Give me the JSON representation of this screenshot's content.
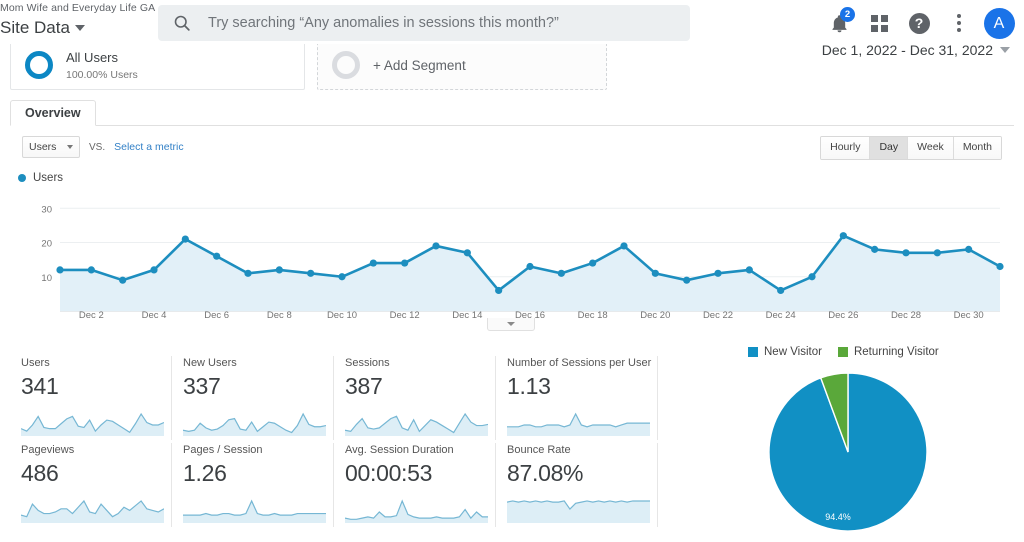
{
  "header": {
    "property_name": "Mom Wife and Everyday Life GA",
    "view_name": "Site Data",
    "search_placeholder": "Try searching “Any anomalies in sessions this month?”",
    "search_value": "",
    "search_icon": "search-icon",
    "notifications_icon": "bell-icon",
    "notifications_badge": "2",
    "apps_icon": "apps-grid-icon",
    "help_icon": "help-icon",
    "help_glyph": "?",
    "more_icon": "kebab-menu-icon",
    "avatar_initial": "A",
    "date_range": "Dec 1, 2022 - Dec 31, 2022"
  },
  "segments": {
    "all_users": {
      "title": "All Users",
      "subtitle": "100.00% Users"
    },
    "add_segment_label": "+ Add Segment"
  },
  "tabs": [
    {
      "label": "Overview",
      "active": true
    }
  ],
  "controls": {
    "metric_selected": "Users",
    "vs_label": "VS.",
    "select_metric_link": "Select a metric",
    "granularity": [
      {
        "label": "Hourly",
        "active": false
      },
      {
        "label": "Day",
        "active": true
      },
      {
        "label": "Week",
        "active": false
      },
      {
        "label": "Month",
        "active": false
      }
    ]
  },
  "colors": {
    "line": "#1d8ebf",
    "area": "#e2f0f8",
    "sparkline": "#76b7d4",
    "spark_area": "#ddeef6",
    "pie_new": "#1190c4",
    "pie_returning": "#5aa83a",
    "accent_link": "#3381c7"
  },
  "chart_data": [
    {
      "type": "line",
      "title": "Users",
      "legend": [
        "Users"
      ],
      "legend_position": "top-left",
      "xlabel": "",
      "ylabel": "",
      "ylim": [
        0,
        33
      ],
      "yticks": [
        10,
        20,
        30
      ],
      "grid": true,
      "x": [
        "Dec 1",
        "Dec 2",
        "Dec 3",
        "Dec 4",
        "Dec 5",
        "Dec 6",
        "Dec 7",
        "Dec 8",
        "Dec 9",
        "Dec 10",
        "Dec 11",
        "Dec 12",
        "Dec 13",
        "Dec 14",
        "Dec 15",
        "Dec 16",
        "Dec 17",
        "Dec 18",
        "Dec 19",
        "Dec 20",
        "Dec 21",
        "Dec 22",
        "Dec 23",
        "Dec 24",
        "Dec 25",
        "Dec 26",
        "Dec 27",
        "Dec 28",
        "Dec 29",
        "Dec 30",
        "Dec 31"
      ],
      "xtick_labels": [
        "Dec 2",
        "Dec 4",
        "Dec 6",
        "Dec 8",
        "Dec 10",
        "Dec 12",
        "Dec 14",
        "Dec 16",
        "Dec 18",
        "Dec 20",
        "Dec 22",
        "Dec 24",
        "Dec 26",
        "Dec 28",
        "Dec 30"
      ],
      "values": [
        12,
        12,
        9,
        12,
        21,
        16,
        11,
        12,
        11,
        10,
        14,
        14,
        19,
        17,
        6,
        13,
        11,
        14,
        19,
        11,
        9,
        11,
        12,
        6,
        10,
        22,
        18,
        17,
        17,
        18,
        13
      ]
    },
    {
      "type": "pie",
      "title": "",
      "legend_position": "top",
      "labels": [
        "New Visitor",
        "Returning Visitor"
      ],
      "values": [
        94.4,
        5.6
      ],
      "data_labels": [
        "94.4%",
        ""
      ],
      "colors": [
        "#1190c4",
        "#5aa83a"
      ]
    }
  ],
  "metric_cards": [
    {
      "label": "Users",
      "value": "341",
      "spark": [
        6,
        4,
        9,
        16,
        7,
        6,
        6,
        10,
        14,
        16,
        8,
        7,
        13,
        4,
        9,
        13,
        12,
        9,
        6,
        3,
        10,
        18,
        11,
        9,
        9,
        11
      ]
    },
    {
      "label": "New Users",
      "value": "337",
      "spark": [
        5,
        4,
        5,
        11,
        7,
        5,
        6,
        9,
        14,
        15,
        6,
        5,
        12,
        4,
        8,
        12,
        11,
        8,
        5,
        3,
        9,
        19,
        10,
        8,
        8,
        9
      ]
    },
    {
      "label": "Sessions",
      "value": "387",
      "spark": [
        5,
        4,
        10,
        15,
        7,
        6,
        7,
        11,
        15,
        17,
        7,
        5,
        14,
        4,
        9,
        14,
        12,
        9,
        6,
        3,
        11,
        19,
        12,
        9,
        9,
        10
      ]
    },
    {
      "label": "Number of Sessions per User",
      "value": "1.13",
      "spark": [
        5,
        5,
        5,
        6,
        6,
        5,
        5,
        6,
        6,
        6,
        5,
        6,
        12,
        6,
        5,
        6,
        6,
        6,
        6,
        5,
        6,
        7,
        7,
        7,
        7,
        7
      ]
    },
    {
      "label": "Pageviews",
      "value": "486",
      "spark": [
        5,
        4,
        12,
        8,
        6,
        6,
        7,
        9,
        9,
        6,
        10,
        14,
        7,
        6,
        12,
        8,
        4,
        6,
        10,
        8,
        11,
        14,
        9,
        8,
        7,
        9
      ]
    },
    {
      "label": "Pages / Session",
      "value": "1.26",
      "spark": [
        5,
        5,
        5,
        5,
        6,
        5,
        5,
        6,
        6,
        5,
        5,
        6,
        14,
        6,
        5,
        5,
        6,
        5,
        5,
        5,
        6,
        6,
        6,
        6,
        6,
        6
      ]
    },
    {
      "label": "Avg. Session Duration",
      "value": "00:00:53",
      "spark": [
        4,
        3,
        3,
        4,
        5,
        4,
        9,
        5,
        5,
        6,
        18,
        7,
        5,
        4,
        4,
        4,
        5,
        4,
        4,
        4,
        5,
        11,
        4,
        9,
        5,
        5
      ]
    },
    {
      "label": "Bounce Rate",
      "value": "87.08%",
      "spark": [
        18,
        19,
        18,
        19,
        18,
        19,
        18,
        19,
        18,
        18,
        19,
        12,
        17,
        18,
        19,
        18,
        19,
        18,
        19,
        18,
        19,
        18,
        19,
        19,
        19,
        19
      ]
    }
  ]
}
